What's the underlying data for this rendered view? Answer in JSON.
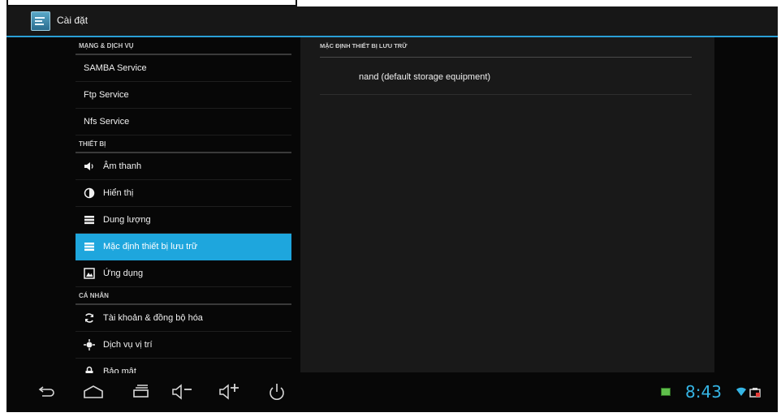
{
  "app": {
    "title": "Cài đặt"
  },
  "left": {
    "sections": [
      {
        "header": "MẠNG & DỊCH VỤ",
        "items": [
          {
            "label": "SAMBA Service"
          },
          {
            "label": "Ftp Service"
          },
          {
            "label": "Nfs Service"
          }
        ]
      },
      {
        "header": "THIẾT BỊ",
        "items": [
          {
            "label": "Âm thanh",
            "icon": "speaker-icon"
          },
          {
            "label": "Hiển thị",
            "icon": "brightness-icon"
          },
          {
            "label": "Dung lượng",
            "icon": "storage-icon"
          },
          {
            "label": "Mặc định thiết bị lưu trữ",
            "icon": "storage-icon",
            "selected": true
          },
          {
            "label": "Ứng dụng",
            "icon": "apps-icon"
          }
        ]
      },
      {
        "header": "CÁ NHÂN",
        "items": [
          {
            "label": "Tài khoản & đồng bộ hóa",
            "icon": "sync-icon"
          },
          {
            "label": "Dịch vụ vị trí",
            "icon": "location-icon"
          },
          {
            "label": "Bảo mật",
            "icon": "lock-icon"
          }
        ]
      }
    ]
  },
  "right": {
    "header": "MẶC ĐỊNH THIẾT BỊ LƯU TRỮ",
    "option": "nand  (default storage equipment)"
  },
  "navbar": {
    "buttons": [
      "back-icon",
      "home-icon",
      "recent-apps-icon",
      "volume-down-icon",
      "volume-up-icon",
      "power-icon"
    ]
  },
  "status": {
    "time": "8:43"
  },
  "colors": {
    "accent": "#1ea6dd",
    "clock": "#35b5e5"
  }
}
